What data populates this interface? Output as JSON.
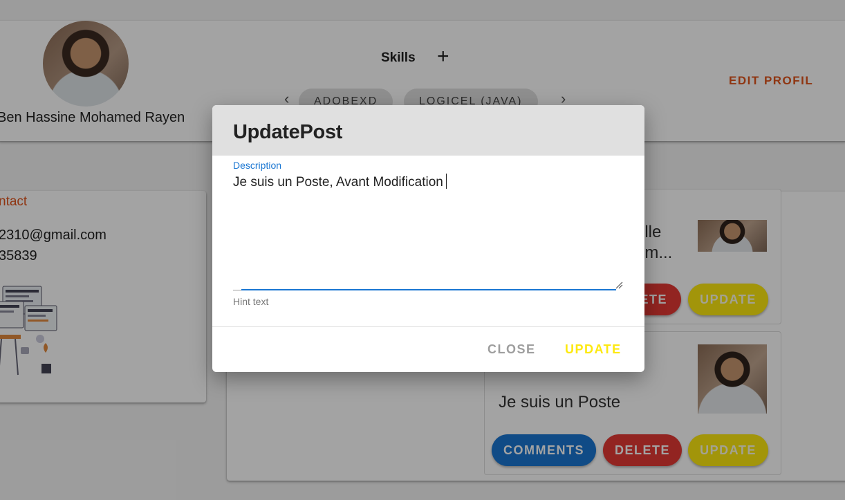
{
  "profile": {
    "name": "Ben Hassine Mohamed Rayen",
    "skills_title": "Skills",
    "add_icon": "+",
    "skills": [
      "ADOBEXD",
      "LOGICEL (JAVA)"
    ],
    "prev_icon": "‹",
    "next_icon": "›",
    "edit_label": "EDIT PROFIL"
  },
  "contact": {
    "title": "ntact",
    "email": "2310@gmail.com",
    "phone": "35839"
  },
  "posts": [
    {
      "text_line1": "elle",
      "text_line2": "um...",
      "delete_label": "ETE",
      "update_label": "UPDATE"
    },
    {
      "text": "Je suis un Poste",
      "comments_label": "COMMENTS",
      "delete_label": "DELETE",
      "update_label": "UPDATE"
    }
  ],
  "dialog": {
    "title": "UpdatePost",
    "field_label": "Description",
    "field_value": "Je suis un Poste, Avant Modification",
    "hint": "Hint text",
    "close_label": "CLOSE",
    "update_label": "UPDATE"
  },
  "colors": {
    "accent_orange": "#e0531c",
    "primary_blue": "#1976d2",
    "danger_red": "#e53935",
    "update_yellow": "#fde910"
  }
}
